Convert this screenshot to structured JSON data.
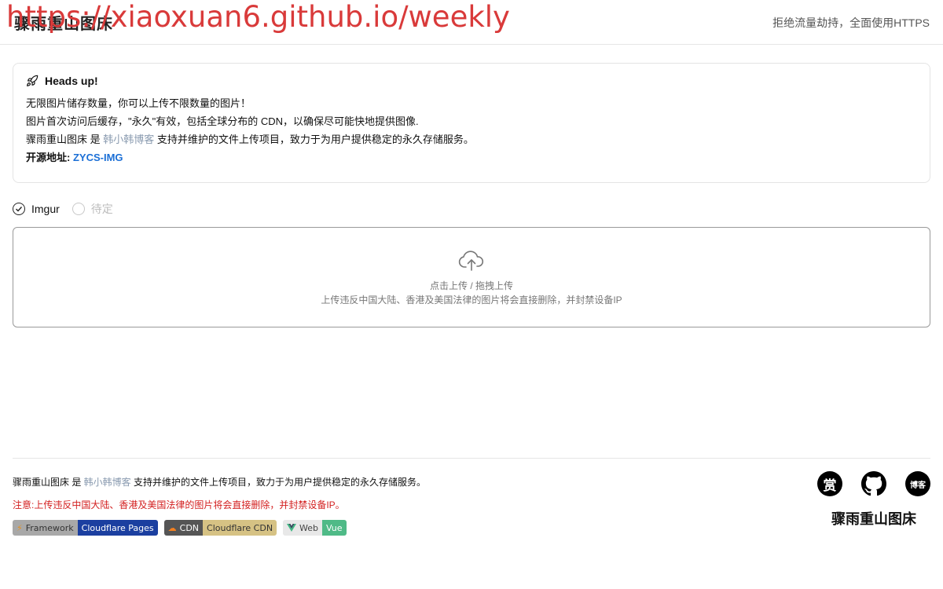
{
  "header": {
    "logo_text": "骤雨重山图床",
    "watermark_url": "https://xiaoxuan6.github.io/weekly",
    "top_right_text": "拒绝流量劫持，全面使用HTTPS"
  },
  "alert": {
    "title": "Heads up!",
    "line1": "无限图片储存数量，你可以上传不限数量的图片！",
    "line2": "图片首次访问后缓存，\"永久\"有效，包括全球分布的 CDN，以确保尽可能快地提供图像.",
    "line3_prefix": "骤雨重山图床 是 ",
    "line3_link": "韩小韩博客",
    "line3_suffix": " 支持并维护的文件上传项目，致力于为用户提供稳定的永久存储服务。",
    "line4_label": "开源地址:",
    "line4_link": "ZYCS-IMG"
  },
  "options": [
    {
      "label": "Imgur",
      "checked": true
    },
    {
      "label": "待定",
      "checked": false
    }
  ],
  "upload": {
    "line1": "点击上传 / 拖拽上传",
    "line2": "上传违反中国大陆、香港及美国法律的图片将会直接删除，并封禁设备IP"
  },
  "footer": {
    "desc_prefix": "骤雨重山图床 是 ",
    "desc_link": "韩小韩博客",
    "desc_suffix": " 支持并维护的文件上传项目，致力于为用户提供稳定的永久存储服务。",
    "note": "注意:上传违反中国大陆、香港及美国法律的图片将会直接删除，并封禁设备IP。",
    "badges": [
      {
        "left": "Framework",
        "right": "Cloudflare Pages"
      },
      {
        "left": "CDN",
        "right": "Cloudflare CDN"
      },
      {
        "left": "Web",
        "right": "Vue"
      }
    ],
    "social": {
      "reward": "赏",
      "blog": "博客"
    },
    "brand": "骤雨重山图床"
  },
  "colors": {
    "watermark": "#d93a3a",
    "note_red": "#d32020",
    "link_blue": "#1b6fd6",
    "muted_link": "#8a9bb0"
  }
}
